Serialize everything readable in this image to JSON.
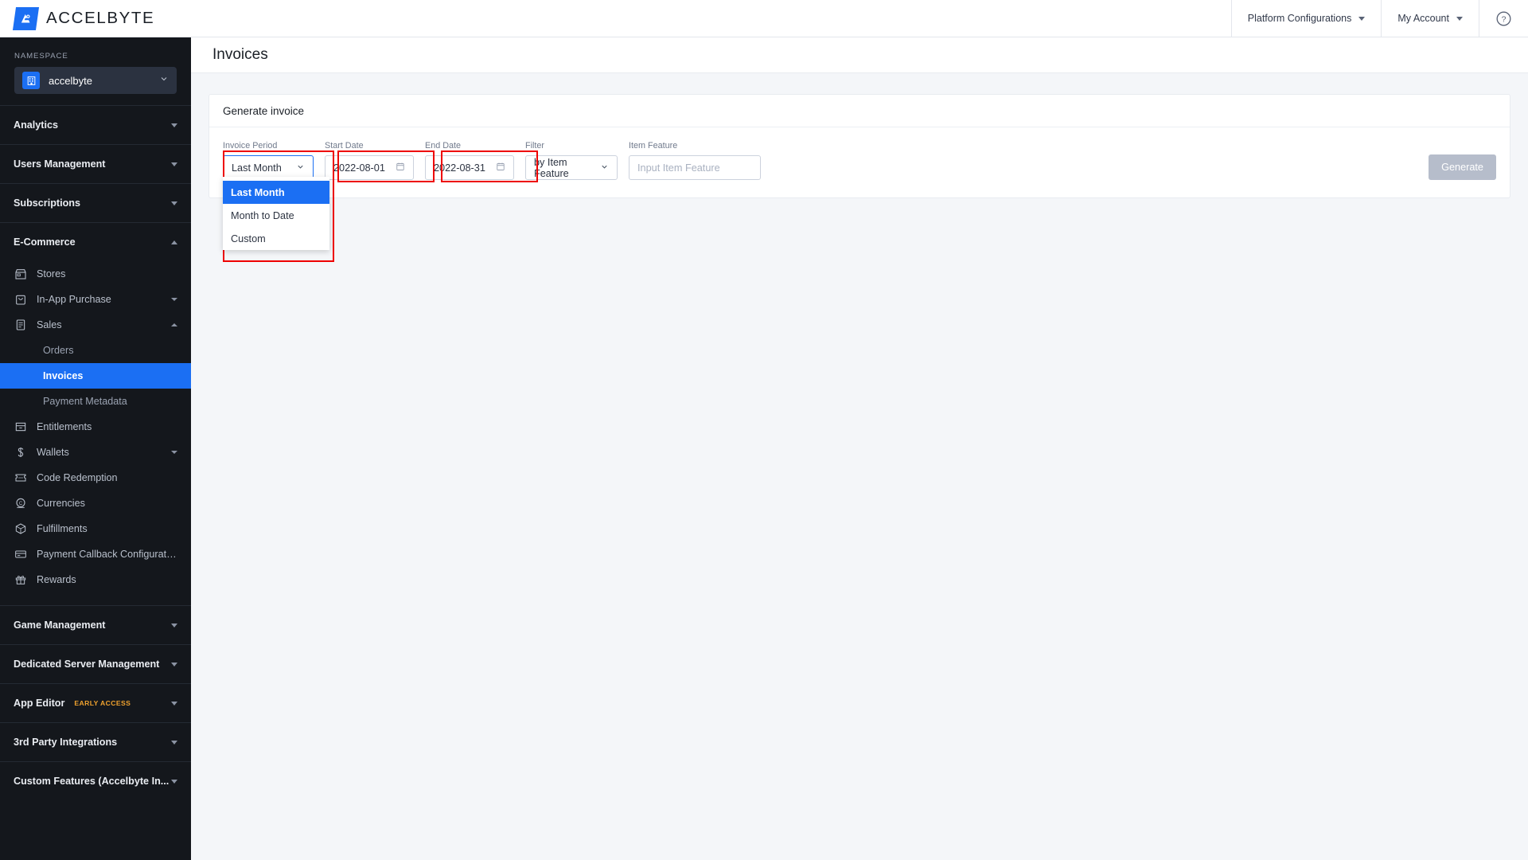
{
  "topbar": {
    "brand": "ACCELBYTE",
    "brand_icon": "accelbyte-logo-icon",
    "platform_configurations": "Platform Configurations",
    "my_account": "My Account",
    "help_icon": "help-circle-icon"
  },
  "sidebar": {
    "namespace_label": "NAMESPACE",
    "namespace_value": "accelbyte",
    "namespace_icon": "building-icon",
    "sections": [
      {
        "title": "Analytics",
        "expanded": false
      },
      {
        "title": "Users Management",
        "expanded": false
      },
      {
        "title": "Subscriptions",
        "expanded": false
      },
      {
        "title": "E-Commerce",
        "expanded": true
      },
      {
        "title": "Game Management",
        "expanded": false
      },
      {
        "title": "Dedicated Server Management",
        "expanded": false
      },
      {
        "title": "App Editor",
        "badge": "EARLY ACCESS",
        "expanded": false
      },
      {
        "title": "3rd Party Integrations",
        "expanded": false
      },
      {
        "title": "Custom Features (Accelbyte In...",
        "expanded": false
      }
    ],
    "ecommerce_items": [
      {
        "label": "Stores",
        "icon": "store-icon"
      },
      {
        "label": "In-App Purchase",
        "icon": "bag-icon",
        "caret": "down"
      },
      {
        "label": "Sales",
        "icon": "clipboard-icon",
        "caret": "up"
      },
      {
        "label": "Entitlements",
        "icon": "drawer-icon"
      },
      {
        "label": "Wallets",
        "icon": "dollar-icon",
        "caret": "down"
      },
      {
        "label": "Code Redemption",
        "icon": "ticket-icon"
      },
      {
        "label": "Currencies",
        "icon": "coin-icon"
      },
      {
        "label": "Fulfillments",
        "icon": "box-icon"
      },
      {
        "label": "Payment Callback Configuration",
        "icon": "card-icon"
      },
      {
        "label": "Rewards",
        "icon": "gift-icon"
      }
    ],
    "sales_subitems": [
      {
        "label": "Orders",
        "active": false
      },
      {
        "label": "Invoices",
        "active": true
      },
      {
        "label": "Payment Metadata",
        "active": false
      }
    ]
  },
  "main": {
    "page_title": "Invoices",
    "card_title": "Generate invoice",
    "fields": {
      "invoice_period": {
        "label": "Invoice Period",
        "value": "Last Month",
        "options": [
          "Last Month",
          "Month to Date",
          "Custom"
        ],
        "selected_index": 0,
        "open": true
      },
      "start_date": {
        "label": "Start Date",
        "value": "2022-08-01",
        "icon": "calendar-icon"
      },
      "end_date": {
        "label": "End Date",
        "value": "2022-08-31",
        "icon": "calendar-icon"
      },
      "filter": {
        "label": "Filter",
        "value": "by Item Feature"
      },
      "item_feature": {
        "label": "Item Feature",
        "value": "",
        "placeholder": "Input Item Feature"
      }
    },
    "generate_button": "Generate"
  },
  "annotations": {
    "highlight_color": "#ee0000",
    "boxes": [
      "invoice-period-and-dropdown",
      "start-date",
      "end-date"
    ]
  }
}
